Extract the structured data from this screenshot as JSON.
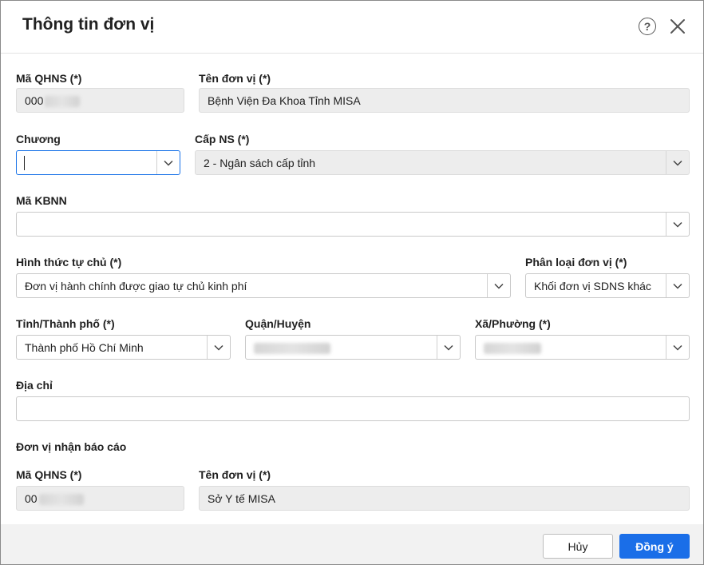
{
  "dialog": {
    "title": "Thông tin đơn vị"
  },
  "unit": {
    "ma_qhns": {
      "label": "Mã QHNS (*)",
      "value": "000"
    },
    "ten_don_vi": {
      "label": "Tên đơn vị (*)",
      "value": "Bệnh Viện Đa Khoa Tỉnh MISA"
    },
    "chuong": {
      "label": "Chương",
      "value": ""
    },
    "cap_ns": {
      "label": "Cấp NS (*)",
      "value": "2 - Ngân sách cấp tỉnh"
    },
    "ma_kbnn": {
      "label": "Mã KBNN",
      "value": ""
    },
    "hinh_thuc_tu_chu": {
      "label": "Hình thức tự chủ (*)",
      "value": "Đơn vị hành chính được giao tự chủ kinh phí"
    },
    "phan_loai": {
      "label": "Phân loại đơn vị (*)",
      "value": "Khối đơn vị SDNS khác"
    },
    "tinh": {
      "label": "Tỉnh/Thành phố (*)",
      "value": "Thành phố Hồ Chí Minh"
    },
    "quan": {
      "label": "Quận/Huyện",
      "value": ""
    },
    "xa": {
      "label": "Xã/Phường (*)",
      "value": ""
    },
    "dia_chi": {
      "label": "Địa chỉ",
      "value": ""
    }
  },
  "report": {
    "section_title": "Đơn vị nhận báo cáo",
    "ma_qhns": {
      "label": "Mã QHNS (*)",
      "value": "00"
    },
    "ten_don_vi": {
      "label": "Tên đơn vị (*)",
      "value": "Sở Y tế MISA"
    }
  },
  "footer": {
    "cancel_label": "Hủy",
    "ok_label": "Đồng ý"
  },
  "icons": {
    "help": "help-circle-icon",
    "close": "close-icon",
    "dropdown": "chevron-down-icon"
  },
  "colors": {
    "primary": "#1a6ee8",
    "focus_border": "#1a73e8",
    "readonly_bg": "#ededed"
  }
}
